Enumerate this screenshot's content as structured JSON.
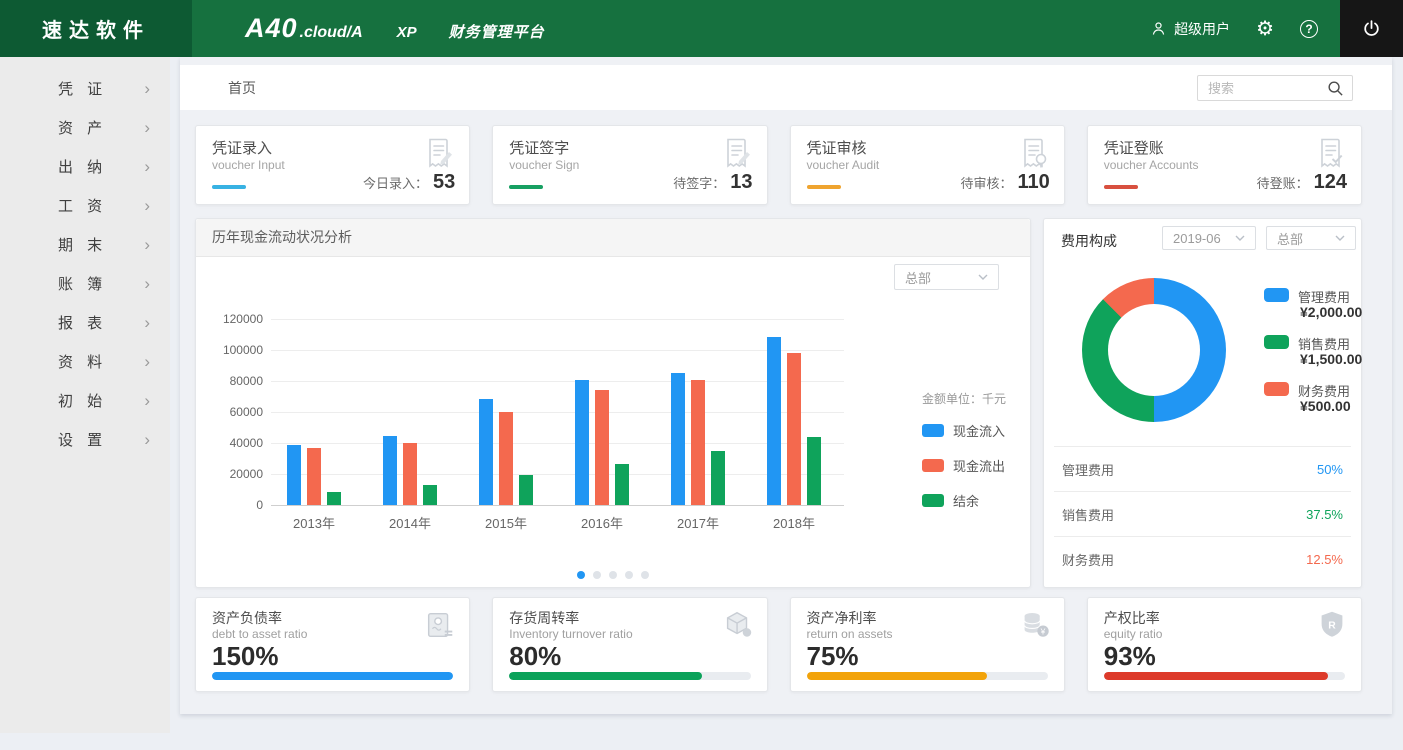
{
  "header": {
    "logo": "速达软件",
    "product": "A40",
    "product_suffix": ".cloud/A",
    "edition": "XP",
    "platform": "财务管理平台",
    "user": "超级用户",
    "icons": [
      "user-icon",
      "gear-icon",
      "help-icon",
      "power-icon"
    ]
  },
  "sidebar": {
    "items": [
      {
        "key": "voucher",
        "label": "凭 证"
      },
      {
        "key": "asset",
        "label": "资 产"
      },
      {
        "key": "cashier",
        "label": "出 纳"
      },
      {
        "key": "payroll",
        "label": "工 资"
      },
      {
        "key": "period-end",
        "label": "期 末"
      },
      {
        "key": "account-books",
        "label": "账 簿"
      },
      {
        "key": "reports",
        "label": "报 表"
      },
      {
        "key": "base-data",
        "label": "资 料"
      },
      {
        "key": "initial",
        "label": "初 始"
      },
      {
        "key": "settings",
        "label": "设 置"
      }
    ]
  },
  "breadcrumb": "首页",
  "search": {
    "placeholder": "搜索"
  },
  "stat_cards": [
    {
      "title": "凭证录入",
      "subtitle": "voucher Input",
      "label": "今日录入：",
      "value": "53",
      "accent": "#38b2e3",
      "icon": "voucher-input-icon"
    },
    {
      "title": "凭证签字",
      "subtitle": "voucher Sign",
      "label": "待签字：",
      "value": "13",
      "accent": "#17a062",
      "icon": "voucher-sign-icon"
    },
    {
      "title": "凭证审核",
      "subtitle": "voucher Audit",
      "label": "待审核：",
      "value": "110",
      "accent": "#efa42f",
      "icon": "voucher-audit-icon"
    },
    {
      "title": "凭证登账",
      "subtitle": "voucher Accounts",
      "label": "待登账：",
      "value": "124",
      "accent": "#d8503f",
      "icon": "voucher-post-icon"
    }
  ],
  "chart_data": [
    {
      "type": "bar",
      "title": "历年现金流动状况分析",
      "branch_selected": "总部",
      "unit_note": "金额单位：千元",
      "categories": [
        "2013年",
        "2014年",
        "2015年",
        "2016年",
        "2017年",
        "2018年"
      ],
      "series": [
        {
          "name": "现金流入",
          "color": "#2196f3",
          "values": [
            39000,
            44500,
            68500,
            80500,
            85000,
            108500
          ]
        },
        {
          "name": "现金流出",
          "color": "#f4694e",
          "values": [
            36500,
            40000,
            60000,
            74000,
            80500,
            98000
          ]
        },
        {
          "name": "结余",
          "color": "#0fa35b",
          "values": [
            8500,
            13000,
            19500,
            26500,
            35000,
            44000
          ]
        }
      ],
      "ylim": [
        0,
        120000
      ],
      "ytick_step": 20000,
      "grid": true,
      "legend_position": "right",
      "dots": 5,
      "active_dot": 0
    },
    {
      "type": "pie",
      "title": "费用构成",
      "period_selected": "2019-06",
      "branch_selected": "总部",
      "slices": [
        {
          "label": "管理费用",
          "amount": "¥2,000.00",
          "percent": "50%",
          "value": 50,
          "color": "#2196f3"
        },
        {
          "label": "销售费用",
          "amount": "¥1,500.00",
          "percent": "37.5%",
          "value": 37.5,
          "color": "#0fa35b"
        },
        {
          "label": "财务费用",
          "amount": "¥500.00",
          "percent": "12.5%",
          "value": 12.5,
          "color": "#f4694e"
        }
      ]
    }
  ],
  "ratio_cards": [
    {
      "title": "资产负债率",
      "subtitle": "debt to asset ratio",
      "value": "150%",
      "fill_percent": 100,
      "color": "#2196f3",
      "icon": "certificate-icon"
    },
    {
      "title": "存货周转率",
      "subtitle": "Inventory turnover ratio",
      "value": "80%",
      "fill_percent": 80,
      "color": "#0ba25a",
      "icon": "cube-icon"
    },
    {
      "title": "资产净利率",
      "subtitle": "return on assets",
      "value": "75%",
      "fill_percent": 75,
      "color": "#f2a30a",
      "icon": "coins-icon"
    },
    {
      "title": "产权比率",
      "subtitle": "equity ratio",
      "value": "93%",
      "fill_percent": 93,
      "color": "#dd3a2a",
      "icon": "shield-icon"
    }
  ]
}
